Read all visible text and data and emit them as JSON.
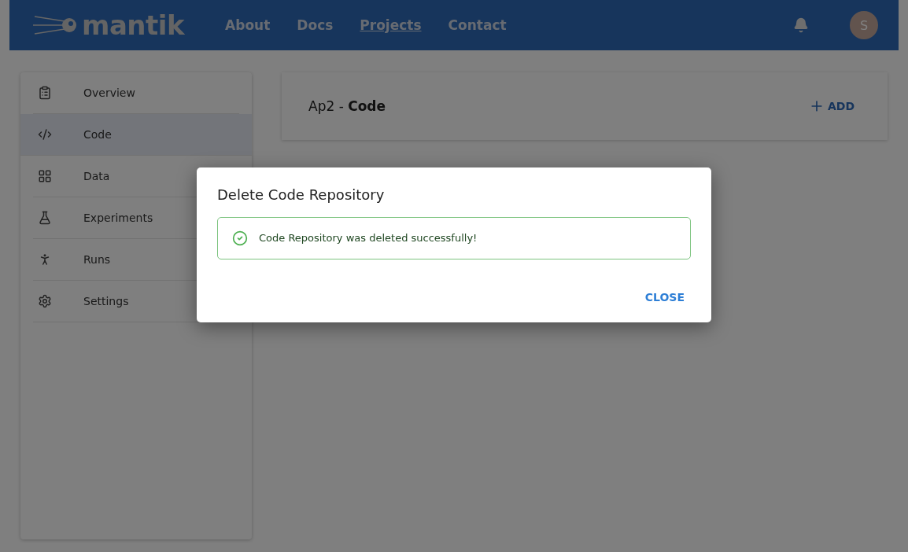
{
  "header": {
    "logo": "mantik",
    "nav": [
      {
        "label": "About",
        "selected": false
      },
      {
        "label": "Docs",
        "selected": false
      },
      {
        "label": "Projects",
        "selected": true
      },
      {
        "label": "Contact",
        "selected": false
      }
    ],
    "avatar": "S"
  },
  "sidebar": {
    "items": [
      {
        "kind": "overview",
        "label": "Overview",
        "selected": false
      },
      {
        "kind": "code",
        "label": "Code",
        "selected": true
      },
      {
        "kind": "data",
        "label": "Data",
        "selected": false
      },
      {
        "kind": "experiments",
        "label": "Experiments",
        "selected": false
      },
      {
        "kind": "runs",
        "label": "Runs",
        "selected": false
      },
      {
        "kind": "settings",
        "label": "Settings",
        "selected": false
      }
    ]
  },
  "content": {
    "title": "Ap2 - **Code**",
    "add_button": "ADD"
  },
  "dialog": {
    "title": "Delete Code Repository",
    "alert": {
      "kind": "success",
      "message": "Code Repository was deleted successfully!"
    },
    "buttons": [
      "CLOSE"
    ]
  }
}
